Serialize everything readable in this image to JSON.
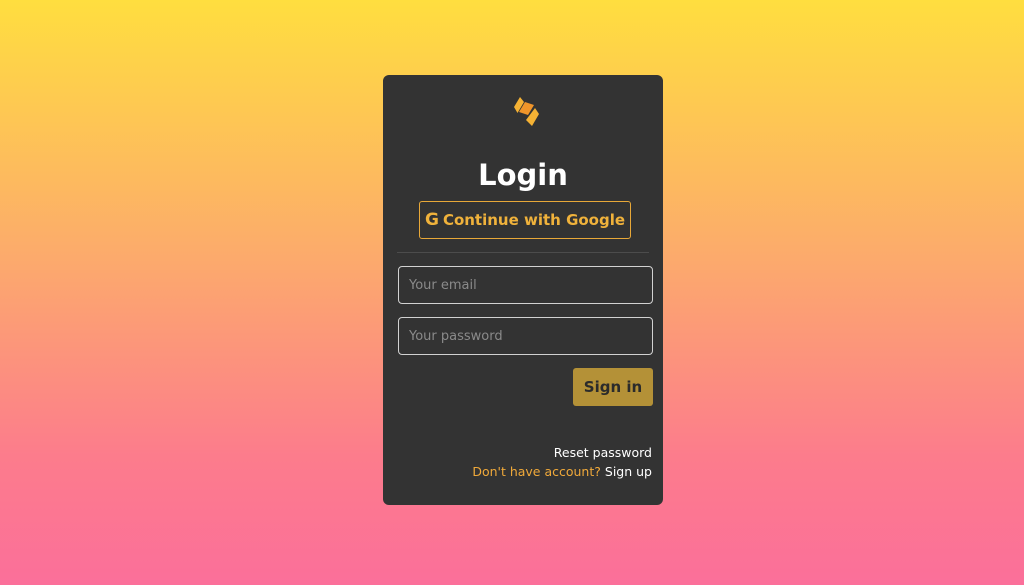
{
  "colors": {
    "background_top": "#ffde3f",
    "background_bottom": "#fb6f9a",
    "card": "#333333",
    "accent": "#f0b23b",
    "signin_button": "#b49137"
  },
  "brand": {
    "logo_icon": "s-logo-icon"
  },
  "login": {
    "title": "Login",
    "google_button": {
      "icon": "google-g-icon",
      "icon_glyph": "G",
      "label": "Continue with Google"
    },
    "email": {
      "placeholder": "Your email",
      "value": ""
    },
    "password": {
      "placeholder": "Your password",
      "value": ""
    },
    "signin_label": "Sign in",
    "reset_password_label": "Reset password",
    "signup_prompt": "Don't have account?",
    "signup_label": "Sign up"
  }
}
